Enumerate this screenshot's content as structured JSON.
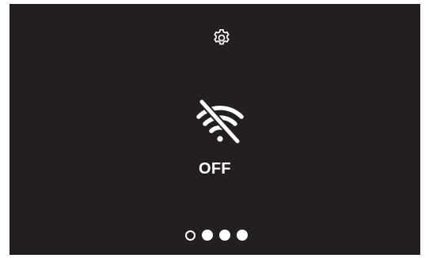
{
  "screen": {
    "background": "#231f20",
    "foreground": "#ffffff"
  },
  "header": {
    "settings_icon": "gear-icon"
  },
  "wifi": {
    "icon": "wifi-off-icon",
    "status_label": "OFF"
  },
  "pager": {
    "dots": [
      {
        "state": "outlined"
      },
      {
        "state": "filled"
      },
      {
        "state": "filled"
      },
      {
        "state": "filled"
      }
    ]
  }
}
